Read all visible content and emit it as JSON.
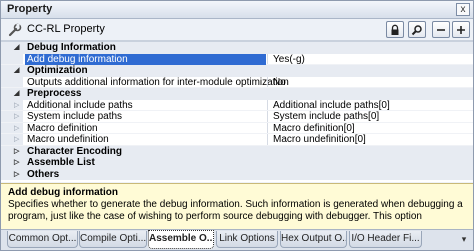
{
  "window": {
    "title": "Property",
    "close_label": "x"
  },
  "toolbar": {
    "panel_title": "CC-RL Property",
    "buttons": [
      "lock-icon",
      "search-icon",
      "collapse-icon",
      "expand-icon"
    ]
  },
  "grid": {
    "rows": [
      {
        "kind": "cat",
        "label": "Debug Information",
        "expanded": true
      },
      {
        "kind": "item",
        "label": "Add debug information",
        "value": "Yes(-g)",
        "selected": true
      },
      {
        "kind": "cat",
        "label": "Optimization",
        "expanded": true
      },
      {
        "kind": "item",
        "label": "Outputs additional information for inter-module optimization",
        "value": "No"
      },
      {
        "kind": "cat",
        "label": "Preprocess",
        "expanded": true
      },
      {
        "kind": "item",
        "label": "Additional include paths",
        "value": "Additional include paths[0]",
        "collapsible": true
      },
      {
        "kind": "item",
        "label": "System include paths",
        "value": "System include paths[0]",
        "collapsible": true
      },
      {
        "kind": "item",
        "label": "Macro definition",
        "value": "Macro definition[0]",
        "collapsible": true
      },
      {
        "kind": "item",
        "label": "Macro undefinition",
        "value": "Macro undefinition[0]",
        "collapsible": true
      },
      {
        "kind": "cat",
        "label": "Character Encoding",
        "expanded": false
      },
      {
        "kind": "cat",
        "label": "Assemble List",
        "expanded": false
      },
      {
        "kind": "cat",
        "label": "Others",
        "expanded": false
      }
    ]
  },
  "description": {
    "title": "Add debug information",
    "text": "Specifies whether to generate the debug information. Such information is generated when debugging a program, just like the case of wishing to perform source debugging with debugger. This option corresponds to..."
  },
  "tabs": {
    "items": [
      {
        "label": "Common Opt...",
        "active": false
      },
      {
        "label": "Compile Opti...",
        "active": false
      },
      {
        "label": "Assemble O...",
        "active": true
      },
      {
        "label": "Link Options",
        "active": false
      },
      {
        "label": "Hex Output O...",
        "active": false
      },
      {
        "label": "I/O Header Fi...",
        "active": false
      }
    ],
    "menu_label": "▾"
  },
  "colors": {
    "selection": "#2f6bd2",
    "description_bg": "#fffbd6",
    "category_bg": "#e7ebf2"
  }
}
